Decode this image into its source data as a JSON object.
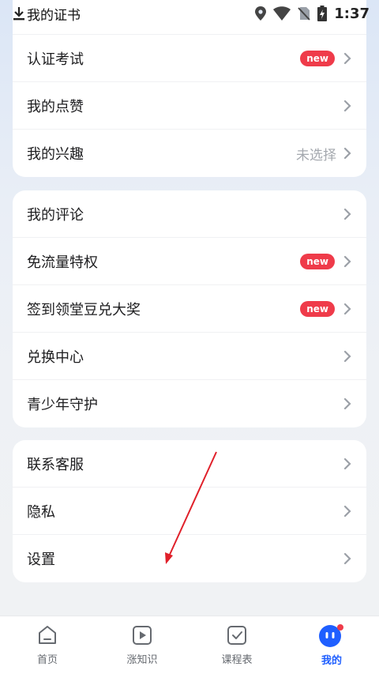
{
  "status_bar": {
    "title": "我的证书",
    "time": "1:37"
  },
  "card1": {
    "items": [
      {
        "label": "认证考试",
        "badge": "new"
      },
      {
        "label": "我的点赞"
      },
      {
        "label": "我的兴趣",
        "meta": "未选择"
      }
    ]
  },
  "card2": {
    "items": [
      {
        "label": "我的评论"
      },
      {
        "label": "免流量特权",
        "badge": "new"
      },
      {
        "label": "签到领堂豆兑大奖",
        "badge": "new"
      },
      {
        "label": "兑换中心"
      },
      {
        "label": "青少年守护"
      }
    ]
  },
  "card3": {
    "items": [
      {
        "label": "联系客服"
      },
      {
        "label": "隐私"
      },
      {
        "label": "设置"
      }
    ]
  },
  "tabbar": {
    "tabs": [
      {
        "label": "首页",
        "icon": "home-icon"
      },
      {
        "label": "涨知识",
        "icon": "play-icon"
      },
      {
        "label": "课程表",
        "icon": "checklist-icon"
      },
      {
        "label": "我的",
        "icon": "profile-face-icon",
        "active": true
      }
    ]
  },
  "colors": {
    "badge": "#ef3b4a",
    "accent": "#1f5fff",
    "annotation_arrow": "#e0202a"
  }
}
